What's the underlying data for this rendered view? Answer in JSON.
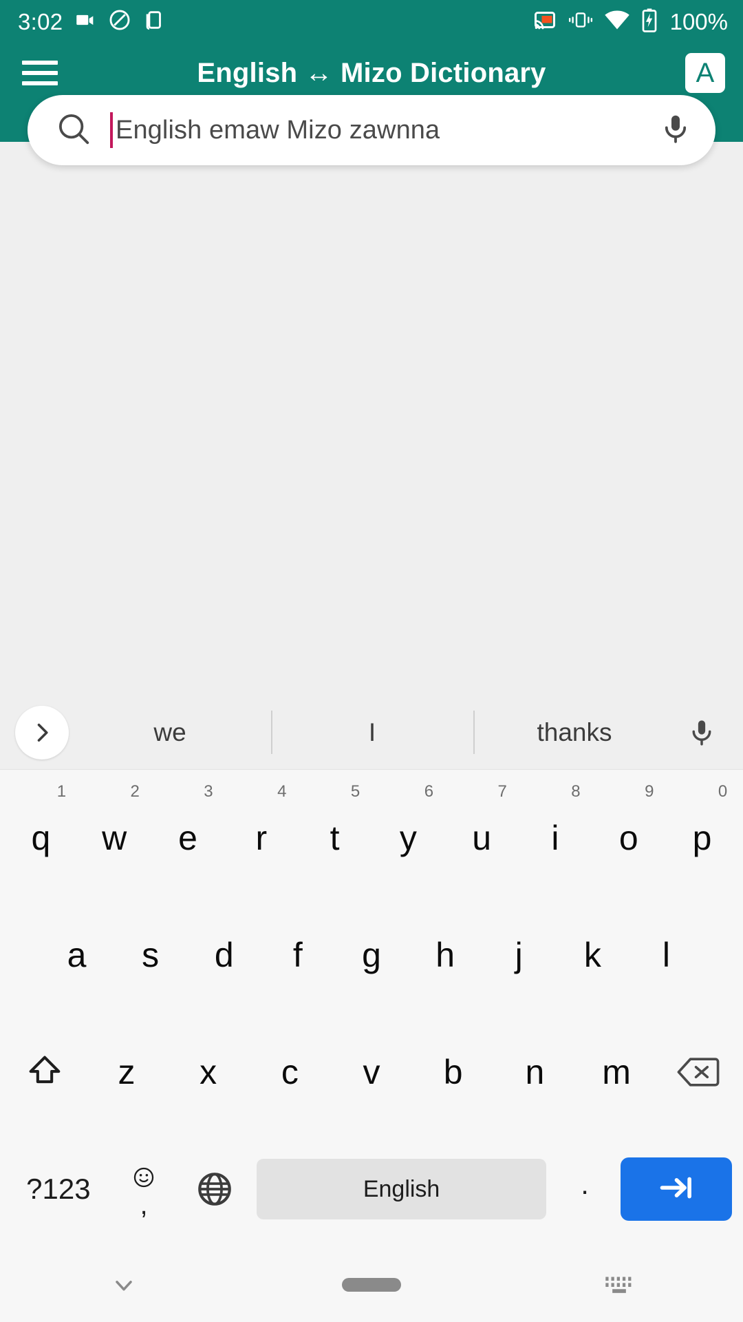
{
  "status_bar": {
    "time": "3:02",
    "battery_text": "100%",
    "left_icons": [
      "video-camera-icon",
      "do-not-disturb-icon",
      "multi-window-icon"
    ],
    "right_icons": [
      "cast-icon",
      "vibrate-icon",
      "wifi-icon",
      "battery-charging-icon"
    ],
    "colors": {
      "background": "#0d8273",
      "foreground": "#ffffff",
      "cast_accent": "#f4511e"
    }
  },
  "app_bar": {
    "menu_icon": "hamburger-menu-icon",
    "title": "English ↔ Mizo Dictionary",
    "lang_button_label": "A",
    "background": "#0d8273"
  },
  "search": {
    "search_icon": "search-icon",
    "placeholder": "English emaw Mizo zawnna",
    "value": "",
    "caret_color": "#c2185b",
    "mic_icon": "microphone-icon"
  },
  "content": {
    "background": "#efefef"
  },
  "keyboard": {
    "suggestions": {
      "expand_icon": "chevron-right-icon",
      "items": [
        "we",
        "I",
        "thanks"
      ],
      "mic_icon": "microphone-icon"
    },
    "row1": [
      {
        "label": "q",
        "hint": "1"
      },
      {
        "label": "w",
        "hint": "2"
      },
      {
        "label": "e",
        "hint": "3"
      },
      {
        "label": "r",
        "hint": "4"
      },
      {
        "label": "t",
        "hint": "5"
      },
      {
        "label": "y",
        "hint": "6"
      },
      {
        "label": "u",
        "hint": "7"
      },
      {
        "label": "i",
        "hint": "8"
      },
      {
        "label": "o",
        "hint": "9"
      },
      {
        "label": "p",
        "hint": "0"
      }
    ],
    "row2": [
      {
        "label": "a"
      },
      {
        "label": "s"
      },
      {
        "label": "d"
      },
      {
        "label": "f"
      },
      {
        "label": "g"
      },
      {
        "label": "h"
      },
      {
        "label": "j"
      },
      {
        "label": "k"
      },
      {
        "label": "l"
      }
    ],
    "row3": {
      "shift_icon": "shift-up-arrow-icon",
      "letters": [
        {
          "label": "z"
        },
        {
          "label": "x"
        },
        {
          "label": "c"
        },
        {
          "label": "v"
        },
        {
          "label": "b"
        },
        {
          "label": "n"
        },
        {
          "label": "m"
        }
      ],
      "backspace_icon": "backspace-delete-icon"
    },
    "row4": {
      "symbols_label": "?123",
      "emoji_icon": "emoji-smiley-icon",
      "comma_label": ",",
      "globe_icon": "globe-language-icon",
      "space_label": "English",
      "period_label": ".",
      "enter_icon": "tab-next-arrow-icon",
      "enter_color": "#1a73e8"
    }
  },
  "nav_bar": {
    "back_icon": "chevron-down-hide-keyboard-icon",
    "home_icon": "home-pill-icon",
    "switch_icon": "keyboard-switcher-icon"
  }
}
